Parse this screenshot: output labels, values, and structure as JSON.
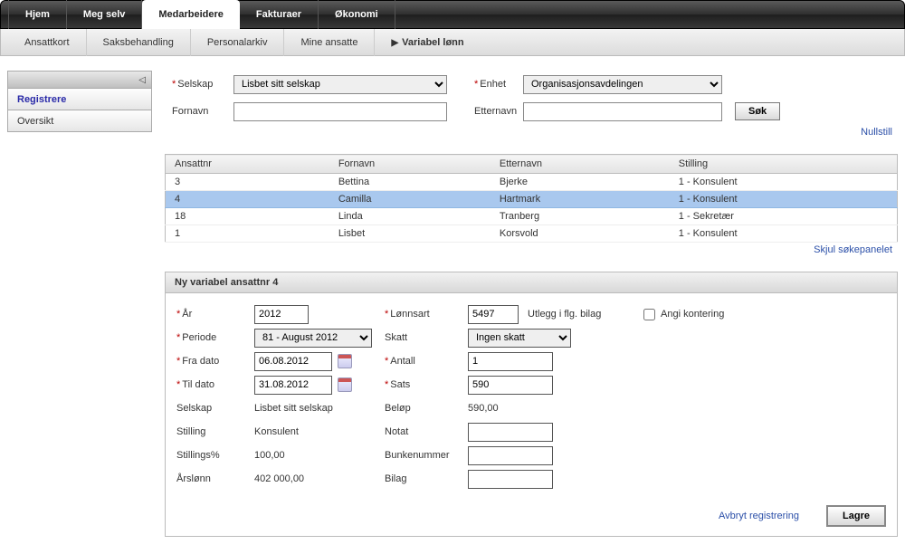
{
  "topTabs": [
    "Hjem",
    "Meg selv",
    "Medarbeidere",
    "Fakturaer",
    "Økonomi"
  ],
  "topActiveIndex": 2,
  "subTabs": [
    "Ansattkort",
    "Saksbehandling",
    "Personalarkiv",
    "Mine ansatte",
    "Variabel lønn"
  ],
  "subCurrentIndex": 4,
  "sidebar": {
    "items": [
      "Registrere",
      "Oversikt"
    ],
    "activeIndex": 0
  },
  "filters": {
    "selskap_label": "Selskap",
    "selskap_value": "Lisbet sitt selskap",
    "enhet_label": "Enhet",
    "enhet_value": "Organisasjonsavdelingen",
    "fornavn_label": "Fornavn",
    "fornavn_value": "",
    "etternavn_label": "Etternavn",
    "etternavn_value": "",
    "sok_btn": "Søk",
    "nullstill": "Nullstill"
  },
  "table": {
    "headers": [
      "Ansattnr",
      "Fornavn",
      "Etternavn",
      "Stilling"
    ],
    "rows": [
      {
        "nr": "3",
        "fornavn": "Bettina",
        "etternavn": "Bjerke",
        "stilling": "1 - Konsulent"
      },
      {
        "nr": "4",
        "fornavn": "Camilla",
        "etternavn": "Hartmark",
        "stilling": "1 - Konsulent"
      },
      {
        "nr": "18",
        "fornavn": "Linda",
        "etternavn": "Tranberg",
        "stilling": "1 - Sekretær"
      },
      {
        "nr": "1",
        "fornavn": "Lisbet",
        "etternavn": "Korsvold",
        "stilling": "1 - Konsulent"
      }
    ],
    "selectedIndex": 1,
    "skjul": "Skjul søkepanelet"
  },
  "form": {
    "title": "Ny variabel ansattnr 4",
    "aar_label": "År",
    "aar": "2012",
    "periode_label": "Periode",
    "periode": "81 - August 2012",
    "fra_label": "Fra dato",
    "fra": "06.08.2012",
    "til_label": "Til dato",
    "til": "31.08.2012",
    "selskap_label": "Selskap",
    "selskap": "Lisbet sitt selskap",
    "stilling_label": "Stilling",
    "stilling": "Konsulent",
    "stillpct_label": "Stillings%",
    "stillpct": "100,00",
    "aarslonn_label": "Årslønn",
    "aarslonn": "402 000,00",
    "lonnsart_label": "Lønnsart",
    "lonnsart": "5497",
    "lonnsart_desc": "Utlegg i flg. bilag",
    "skatt_label": "Skatt",
    "skatt": "Ingen skatt",
    "antall_label": "Antall",
    "antall": "1",
    "sats_label": "Sats",
    "sats": "590",
    "belop_label": "Beløp",
    "belop": "590,00",
    "notat_label": "Notat",
    "notat": "",
    "bunke_label": "Bunkenummer",
    "bunke": "",
    "bilag_label": "Bilag",
    "bilag": "",
    "kontering_label": "Angi kontering",
    "avbryt": "Avbryt registrering",
    "lagre": "Lagre"
  }
}
